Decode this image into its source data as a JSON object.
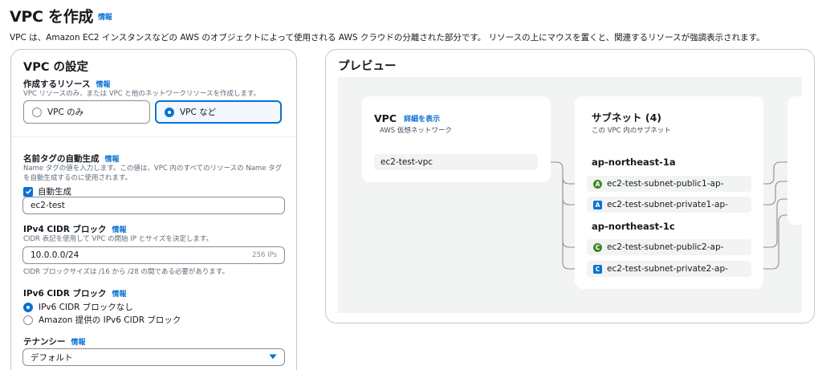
{
  "header": {
    "title": "VPC を作成",
    "info": "情報",
    "description": "VPC は、Amazon EC2 インスタンスなどの AWS のオブジェクトによって使用される AWS クラウドの分離された部分です。 リソースの上にマウスを置くと、関連するリソースが強調表示されます。"
  },
  "settings": {
    "title": "VPC の設定",
    "resources": {
      "label": "作成するリソース",
      "info": "情報",
      "hint": "VPC リソースのみ、または VPC と他のネットワークリソースを作成します。",
      "options": [
        "VPC のみ",
        "VPC など"
      ],
      "selected": "VPC など"
    },
    "name_tag": {
      "label": "名前タグの自動生成",
      "info": "情報",
      "hint1": "Name タグの値を入力します。この値は、VPC 内のすべてのリソースの Name タグ",
      "hint2": "を自動生成するのに使用されます。",
      "checkbox_label": "自動生成",
      "value": "ec2-test"
    },
    "ipv4": {
      "label": "IPv4 CIDR ブロック",
      "info": "情報",
      "hint": "CIDR 表記を使用して VPC の開始 IP とサイズを決定します。",
      "value": "10.0.0.0/24",
      "count": "256 IPs",
      "constraint": "CIDR ブロックサイズは /16 から /28 の間である必要があります。"
    },
    "ipv6": {
      "label": "IPv6 CIDR ブロック",
      "info": "情報",
      "options": [
        "IPv6 CIDR ブロックなし",
        "Amazon 提供の IPv6 CIDR ブロック"
      ],
      "selected": "IPv6 CIDR ブロックなし"
    },
    "tenancy": {
      "label": "テナンシー",
      "info": "情報",
      "value": "デフォルト"
    }
  },
  "preview": {
    "title": "プレビュー",
    "vpc": {
      "title": "VPC",
      "link": "詳細を表示",
      "subtitle": "AWS 仮想ネットワーク",
      "name": "ec2-test-vpc"
    },
    "subnets": {
      "title": "サブネット (4)",
      "subtitle": "この VPC 内のサブネット",
      "zones": [
        {
          "name": "ap-northeast-1a",
          "items": [
            {
              "badge": "A",
              "type": "public",
              "label": "ec2-test-subnet-public1-ap-"
            },
            {
              "badge": "A",
              "type": "private",
              "label": "ec2-test-subnet-private1-ap-"
            }
          ]
        },
        {
          "name": "ap-northeast-1c",
          "items": [
            {
              "badge": "C",
              "type": "public",
              "label": "ec2-test-subnet-public2-ap-"
            },
            {
              "badge": "C",
              "type": "private",
              "label": "ec2-test-subnet-private2-ap-"
            }
          ]
        }
      ]
    }
  },
  "colors": {
    "link": "#0972d3",
    "public_badge": "#3f8624",
    "private_badge": "#0972d3",
    "canvas": "#f2f3f3"
  }
}
